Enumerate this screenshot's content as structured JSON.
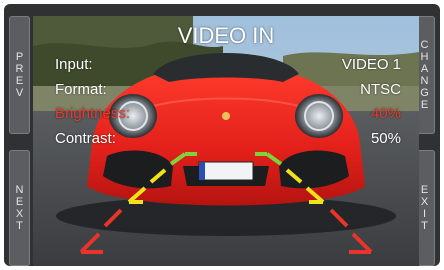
{
  "screen": {
    "title": "VIDEO IN"
  },
  "settings": [
    {
      "label": "Input:",
      "value": "VIDEO 1",
      "highlighted": false
    },
    {
      "label": "Format:",
      "value": "NTSC",
      "highlighted": false
    },
    {
      "label": "Brightness:",
      "value": "40%",
      "highlighted": true
    },
    {
      "label": "Contrast:",
      "value": "50%",
      "highlighted": false
    }
  ],
  "buttons": {
    "prev": "PREV",
    "next": "NEXT",
    "change": "CHANGE",
    "exit": "EXIT"
  },
  "colors": {
    "highlight": "#e53a2e",
    "text": "#ffffff",
    "guide_near": "#e8342a",
    "guide_mid": "#f2e21a",
    "guide_far": "#7ed23a"
  }
}
